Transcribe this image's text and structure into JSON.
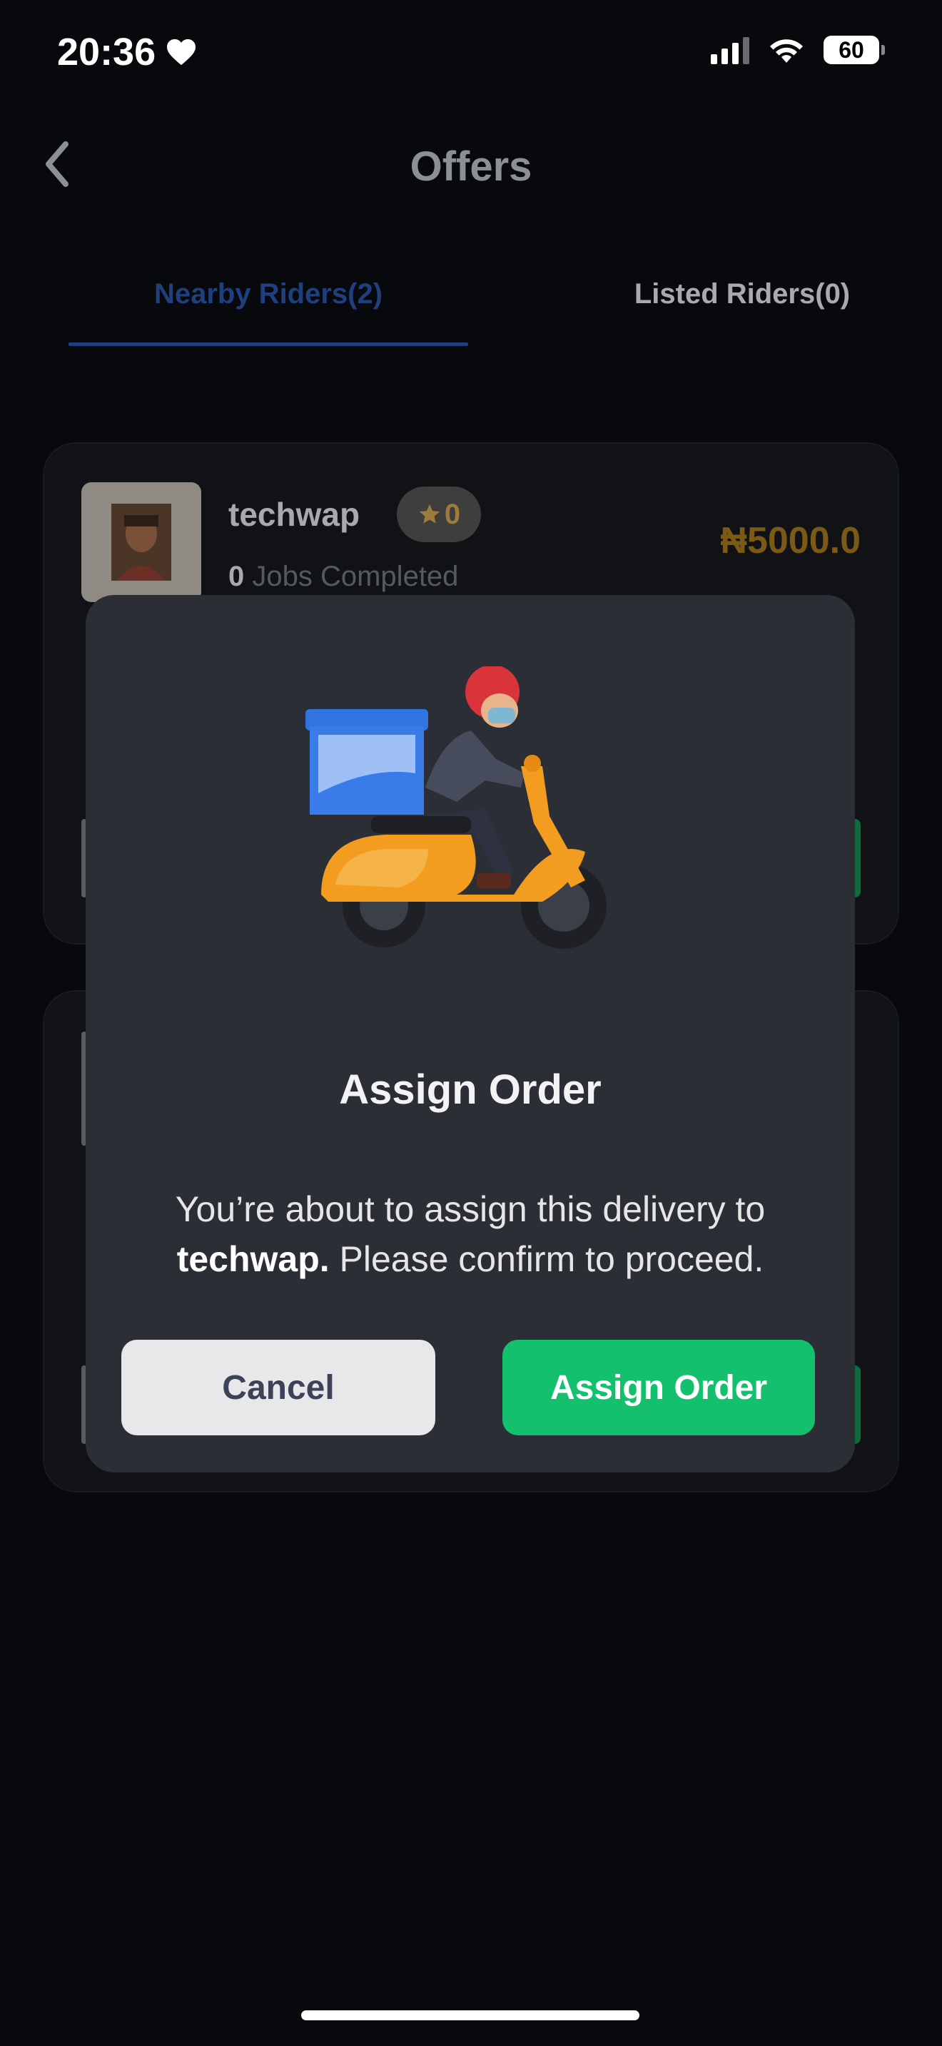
{
  "status_bar": {
    "time": "20:36",
    "battery": "60"
  },
  "header": {
    "title": "Offers"
  },
  "tabs": [
    {
      "label": "Nearby Riders(2)",
      "active": true
    },
    {
      "label": "Listed Riders(0)",
      "active": false
    }
  ],
  "riders": [
    {
      "name": "techwap",
      "rating": "0",
      "jobs_count": "0",
      "jobs_label": "Jobs Completed",
      "price": "₦5000.0"
    }
  ],
  "modal": {
    "title": "Assign Order",
    "message_before": "You’re about to assign this delivery to ",
    "rider_name": "techwap.",
    "message_after": " Please confirm to proceed.",
    "cancel_label": "Cancel",
    "confirm_label": "Assign Order"
  },
  "colors": {
    "accent_tab": "#1f3f7e",
    "confirm_button": "#14c06d",
    "price": "#7b5a15"
  },
  "icons": {
    "back": "chevron-left-icon",
    "star": "star-icon",
    "signal": "cellular-signal-icon",
    "wifi": "wifi-icon",
    "battery": "battery-icon",
    "heart": "heart-icon"
  }
}
